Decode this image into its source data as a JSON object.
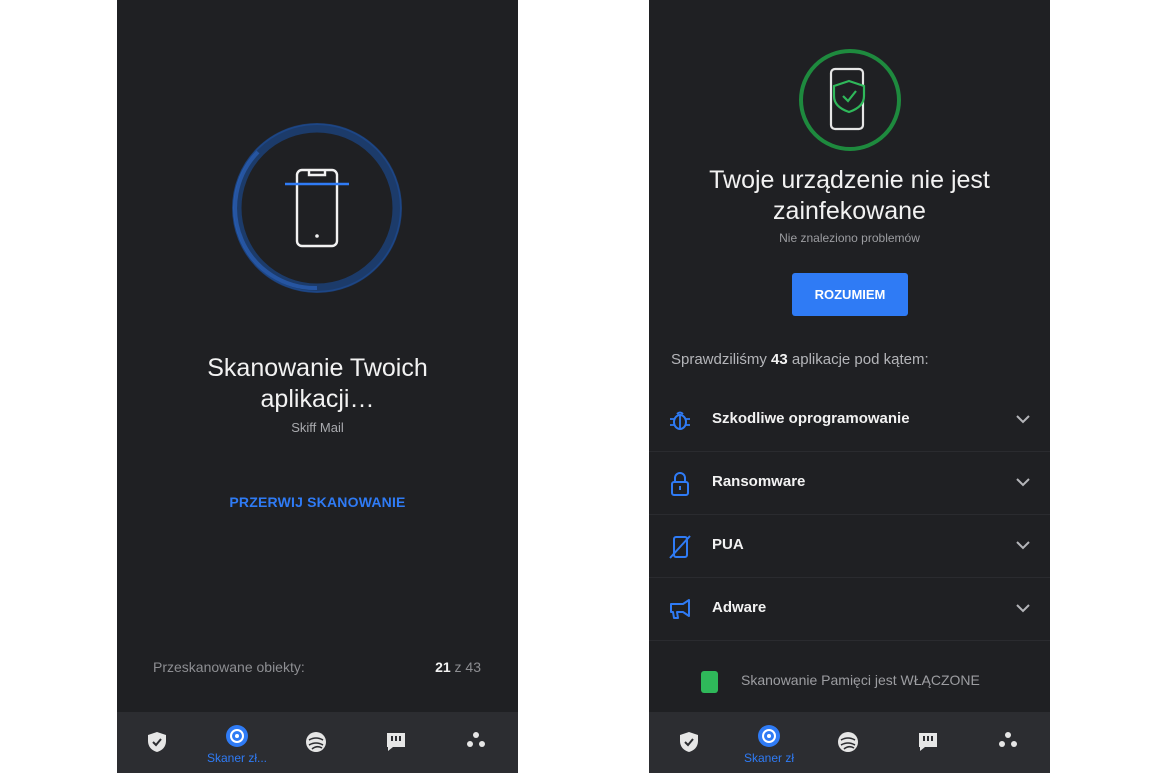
{
  "left_screen": {
    "title_line1": "Skanowanie Twoich",
    "title_line2": "aplikacji…",
    "current_app": "Skiff Mail",
    "stop_button": "PRZERWIJ SKANOWANIE",
    "scanned_label": "Przeskanowane obiekty:",
    "scanned_count": "21",
    "scanned_of": "z 43",
    "progress_fraction": 0.49
  },
  "right_screen": {
    "title_line1": "Twoje urządzenie nie jest",
    "title_line2": "zainfekowane",
    "subtitle": "Nie znaleziono problemów",
    "ok_button": "ROZUMIEM",
    "checked_prefix": "Sprawdziliśmy",
    "checked_count": "43",
    "checked_suffix": "aplikacje pod kątem:",
    "threats": [
      {
        "label": "Szkodliwe oprogramowanie",
        "icon": "bug-icon"
      },
      {
        "label": "Ransomware",
        "icon": "lock-icon"
      },
      {
        "label": "PUA",
        "icon": "crossed-phone-icon"
      },
      {
        "label": "Adware",
        "icon": "megaphone-icon"
      }
    ],
    "memory_scan_text": "Skanowanie Pamięci jest WŁĄCZONE"
  },
  "nav": {
    "items": [
      {
        "icon": "shield-icon"
      },
      {
        "icon": "scanner-icon",
        "label": "Skaner zł...",
        "active": true
      },
      {
        "icon": "web-icon"
      },
      {
        "icon": "message-icon"
      },
      {
        "icon": "more-icon"
      }
    ],
    "right_active_label": "Skaner zł"
  },
  "colors": {
    "background": "#1f2023",
    "accent": "#2f7bf5",
    "success": "#2fb85a",
    "navbar": "#2c2d31"
  }
}
